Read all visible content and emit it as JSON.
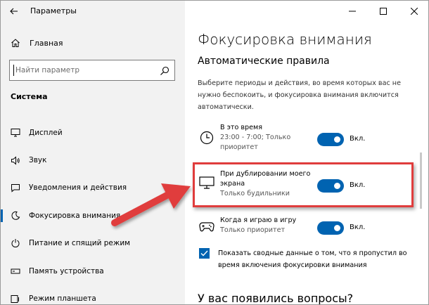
{
  "window": {
    "app_title": "Параметры"
  },
  "sidebar": {
    "home_label": "Главная",
    "search_placeholder": "Найти параметр",
    "section_label": "Система",
    "items": [
      {
        "label": "Дисплей",
        "icon": "display-icon"
      },
      {
        "label": "Звук",
        "icon": "sound-icon"
      },
      {
        "label": "Уведомления и действия",
        "icon": "notifications-icon"
      },
      {
        "label": "Фокусировка внимания",
        "icon": "focus-assist-icon",
        "active": true
      },
      {
        "label": "Питание и спящий режим",
        "icon": "power-icon"
      },
      {
        "label": "Память устройства",
        "icon": "storage-icon"
      },
      {
        "label": "Режим планшета",
        "icon": "tablet-mode-icon"
      }
    ]
  },
  "main": {
    "title": "Фокусировка внимания",
    "subtitle": "Автоматические правила",
    "description": "Выберите периоды и действия, во время которых вас не нужно беспокоить, и фокусировка внимания включится автоматически.",
    "rules": [
      {
        "title": "В это время",
        "subtitle": "23:00 - 7:00; Только приоритет",
        "toggle_on": true,
        "toggle_label": "Вкл.",
        "icon": "clock-icon"
      },
      {
        "title": "При дублировании моего экрана",
        "subtitle": "Только будильники",
        "toggle_on": true,
        "toggle_label": "Вкл.",
        "icon": "monitor-icon"
      },
      {
        "title": "Когда я играю в игру",
        "subtitle": "Только приоритет",
        "toggle_on": true,
        "toggle_label": "Вкл.",
        "icon": "gamepad-icon"
      }
    ],
    "summary_checkbox": {
      "checked": true,
      "label": "Показать сводные данные о том, что я пропустил во время включения фокусировки внимания"
    },
    "questions_heading": "У вас появились вопросы?"
  },
  "colors": {
    "accent": "#0063b1",
    "highlight": "#e03c3c",
    "sidebar_bg": "#f2f2f2"
  }
}
